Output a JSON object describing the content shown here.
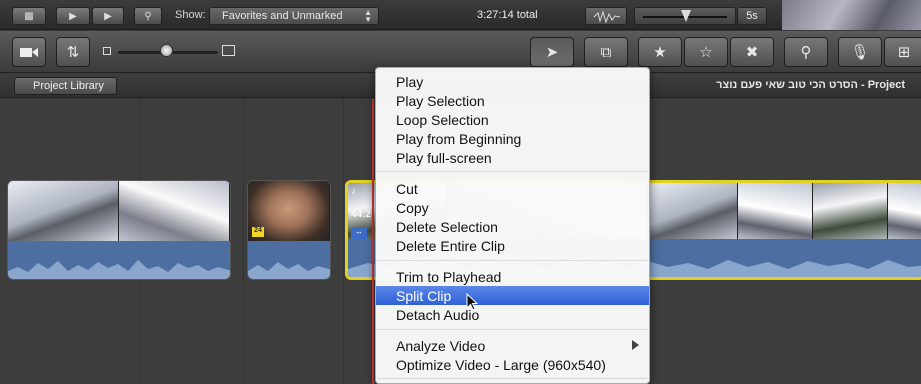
{
  "top_bar": {
    "show_label": "Show:",
    "show_select_value": "Favorites and Unmarked",
    "total_duration": "3:27:14 total",
    "thumb_duration": "5s"
  },
  "toolbar": {
    "tools": [
      "camera-import",
      "swap-library",
      "pointer",
      "crop-clip",
      "favorite",
      "unmark",
      "reject",
      "keyword",
      "voiceover",
      "crop"
    ]
  },
  "project": {
    "library_button": "Project Library",
    "title": "הסרט הכי טוב שאי פעם נוצר - Project"
  },
  "clips": {
    "badge_2": "24",
    "selected_time": "44:2",
    "selected_vol": "♪"
  },
  "context_menu": {
    "items": [
      "Play",
      "Play Selection",
      "Loop Selection",
      "Play from Beginning",
      "Play full-screen",
      "Cut",
      "Copy",
      "Delete Selection",
      "Delete Entire Clip",
      "Trim to Playhead",
      "Split Clip",
      "Detach Audio",
      "Analyze Video",
      "Optimize Video - Large (960x540)"
    ],
    "highlighted": "Split Clip"
  },
  "colors": {
    "selection_yellow": "#e2d120",
    "menu_highlight": "#3b6ddc",
    "playhead": "#d23b3b",
    "audio_wave": "#4c6ea0"
  }
}
